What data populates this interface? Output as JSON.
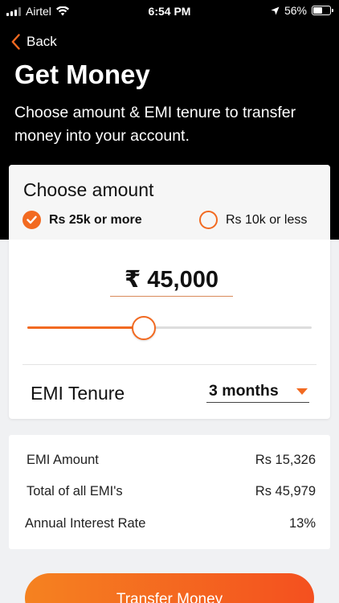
{
  "status_bar": {
    "carrier": "Airtel",
    "time": "6:54 PM",
    "battery": "56%",
    "battery_level": 0.56
  },
  "header": {
    "back_label": "Back",
    "title": "Get Money",
    "subtitle": "Choose amount & EMI tenure to transfer money into your account."
  },
  "amount_card": {
    "heading": "Choose amount",
    "options": [
      {
        "label": "Rs 25k or more",
        "selected": true
      },
      {
        "label": "Rs 10k or less",
        "selected": false
      }
    ],
    "amount": "₹ 45,000",
    "slider_fraction": 0.41,
    "emi_tenure_label": "EMI Tenure",
    "tenure_value": "3 months"
  },
  "summary": {
    "rows": [
      {
        "label": "EMI Amount",
        "value": "Rs 15,326"
      },
      {
        "label": "Total of all EMI's",
        "value": "Rs 45,979"
      },
      {
        "label": "Annual Interest Rate",
        "value": "13%"
      }
    ]
  },
  "cta": {
    "label": "Transfer Money"
  },
  "colors": {
    "accent": "#f26a21",
    "header_bg": "#000000",
    "page_bg": "#f0f1f3"
  }
}
